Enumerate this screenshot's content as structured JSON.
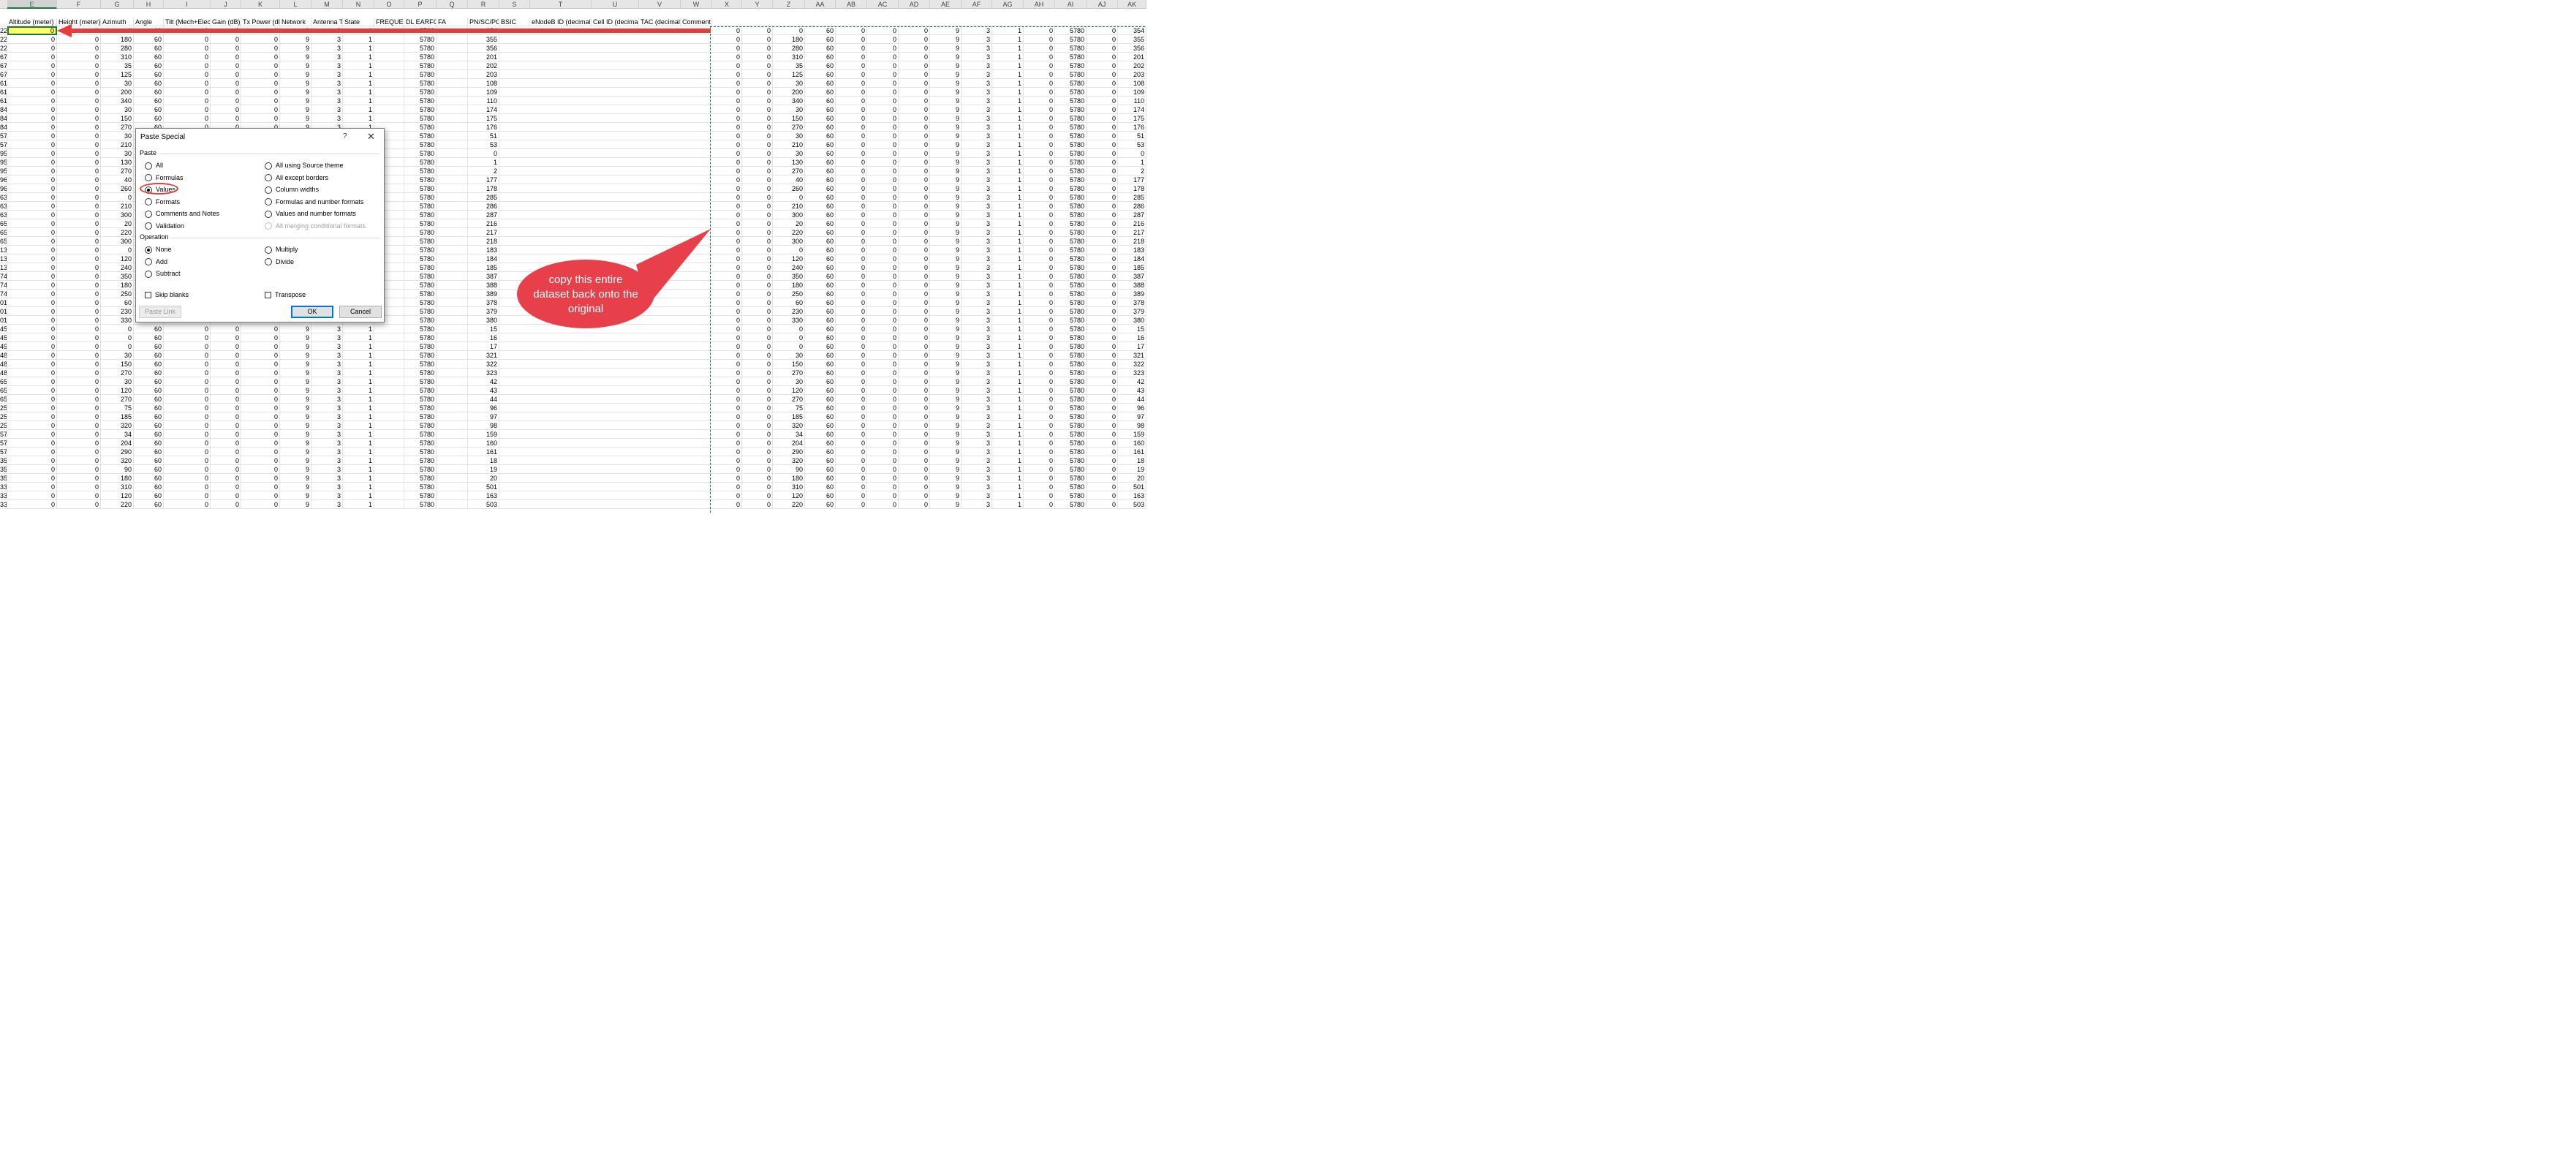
{
  "columns": {
    "letters": [
      "E",
      "F",
      "G",
      "H",
      "I",
      "J",
      "K",
      "L",
      "M",
      "N",
      "O",
      "P",
      "Q",
      "R",
      "S",
      "T",
      "U",
      "V",
      "W",
      "X",
      "Y",
      "Z",
      "AA",
      "AB",
      "AC",
      "AD",
      "AE",
      "AF",
      "AG",
      "AH",
      "AI",
      "AJ",
      "AK"
    ],
    "active_letter": "E"
  },
  "headers": [
    "Altitude (meter)",
    "Height (meter)",
    "Azimuth",
    "Angle",
    "Tilt (Mech+Elec)",
    "Gain (dB)",
    "Tx Power (dB)",
    "Network",
    "Antenna Ty",
    "State",
    "FREQUENC",
    "DL EARFCN",
    "FA",
    "PN/SC/PCI",
    "BSIC",
    "eNodeB ID (decimal)",
    "Cell ID (decimal)",
    "TAC (decimal)",
    "Comment"
  ],
  "row_numbers": [
    "22",
    "22",
    "22",
    "67",
    "67",
    "67",
    "61",
    "61",
    "61",
    "84",
    "84",
    "84",
    "57",
    "57",
    "95",
    "95",
    "95",
    "96",
    "96",
    "63",
    "63",
    "63",
    "65",
    "65",
    "65",
    "13",
    "13",
    "13",
    "74",
    "74",
    "74",
    "01",
    "01",
    "01",
    "45",
    "45",
    "45",
    "48",
    "48",
    "48",
    "65",
    "65",
    "65",
    "25",
    "25",
    "25",
    "57",
    "57",
    "57",
    "35",
    "35",
    "35",
    "33",
    "33",
    "33"
  ],
  "azimuths": [
    "0",
    "180",
    "280",
    "310",
    "35",
    "125",
    "30",
    "200",
    "340",
    "30",
    "150",
    "270",
    "30",
    "210",
    "30",
    "130",
    "270",
    "40",
    "260",
    "0",
    "210",
    "300",
    "20",
    "220",
    "300",
    "0",
    "120",
    "240",
    "350",
    "180",
    "250",
    "60",
    "230",
    "330",
    "0",
    "0",
    "0",
    "30",
    "150",
    "270",
    "30",
    "120",
    "270",
    "75",
    "185",
    "320",
    "34",
    "204",
    "290",
    "320",
    "90",
    "180",
    "310",
    "120",
    "220"
  ],
  "pci": [
    "354",
    "355",
    "356",
    "201",
    "202",
    "203",
    "108",
    "109",
    "110",
    "174",
    "175",
    "176",
    "51",
    "53",
    "0",
    "1",
    "2",
    "177",
    "178",
    "285",
    "286",
    "287",
    "216",
    "217",
    "218",
    "183",
    "184",
    "185",
    "387",
    "388",
    "389",
    "378",
    "379",
    "380",
    "15",
    "16",
    "17",
    "321",
    "322",
    "323",
    "42",
    "43",
    "44",
    "96",
    "97",
    "98",
    "159",
    "160",
    "161",
    "18",
    "19",
    "20",
    "501",
    "163",
    "503"
  ],
  "constants": {
    "zero": "0",
    "angle": "60",
    "network": "9",
    "antenna": "3",
    "state": "1",
    "earfcn": "5780"
  },
  "dialog": {
    "title": "Paste Special",
    "help": "?",
    "close": "✕",
    "paste_group": "Paste",
    "paste_left": [
      {
        "label": "All",
        "selected": false
      },
      {
        "label": "Formulas",
        "selected": false
      },
      {
        "label": "Values",
        "selected": true
      },
      {
        "label": "Formats",
        "selected": false
      },
      {
        "label": "Comments and Notes",
        "selected": false
      },
      {
        "label": "Validation",
        "selected": false
      }
    ],
    "paste_right": [
      {
        "label": "All using Source theme",
        "disabled": false
      },
      {
        "label": "All except borders",
        "disabled": false
      },
      {
        "label": "Column widths",
        "disabled": false
      },
      {
        "label": "Formulas and number formats",
        "disabled": false
      },
      {
        "label": "Values and number formats",
        "disabled": false
      },
      {
        "label": "All merging conditional formats",
        "disabled": true
      }
    ],
    "operation_group": "Operation",
    "operation_left": [
      {
        "label": "None",
        "selected": true
      },
      {
        "label": "Add",
        "selected": false
      },
      {
        "label": "Subtract",
        "selected": false
      }
    ],
    "operation_right": [
      {
        "label": "Multiply",
        "selected": false
      },
      {
        "label": "Divide",
        "selected": false
      }
    ],
    "skip_blanks": "Skip blanks",
    "transpose": "Transpose",
    "paste_link": "Paste Link",
    "ok": "OK",
    "cancel": "Cancel"
  },
  "callout": {
    "text": "copy this entire dataset back onto the original",
    "color": "#e8404a"
  },
  "colors": {
    "selection_fill": "#ffff66",
    "excel_green": "#217346",
    "arrow_red": "#e63c3c"
  }
}
